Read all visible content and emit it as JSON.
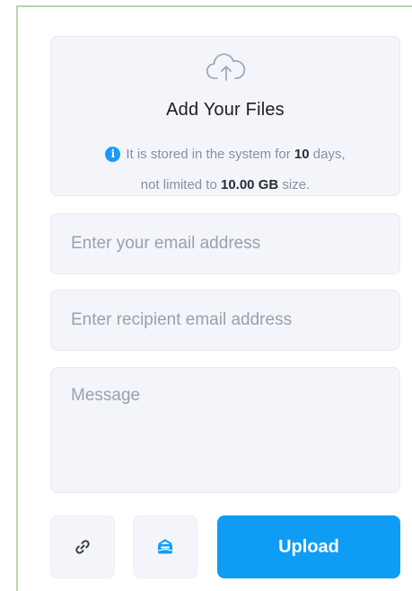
{
  "dropzone": {
    "icon": "cloud-upload-icon",
    "title": "Add Your Files",
    "info_icon": "info-icon",
    "info_part1": "It is stored in the system for ",
    "days": "10",
    "info_part2": " days,",
    "info_line2_part1": "not limited to ",
    "size": "10.00 GB",
    "info_line2_part2": " size."
  },
  "form": {
    "email_placeholder": "Enter your email address",
    "recipient_placeholder": "Enter recipient email address",
    "message_placeholder": "Message"
  },
  "actions": {
    "link_icon": "link-icon",
    "mail_icon": "mail-icon",
    "upload_label": "Upload"
  },
  "colors": {
    "accent": "#0f9cf5",
    "panel": "#f3f5fa",
    "frame_border": "#b9d3a8"
  }
}
